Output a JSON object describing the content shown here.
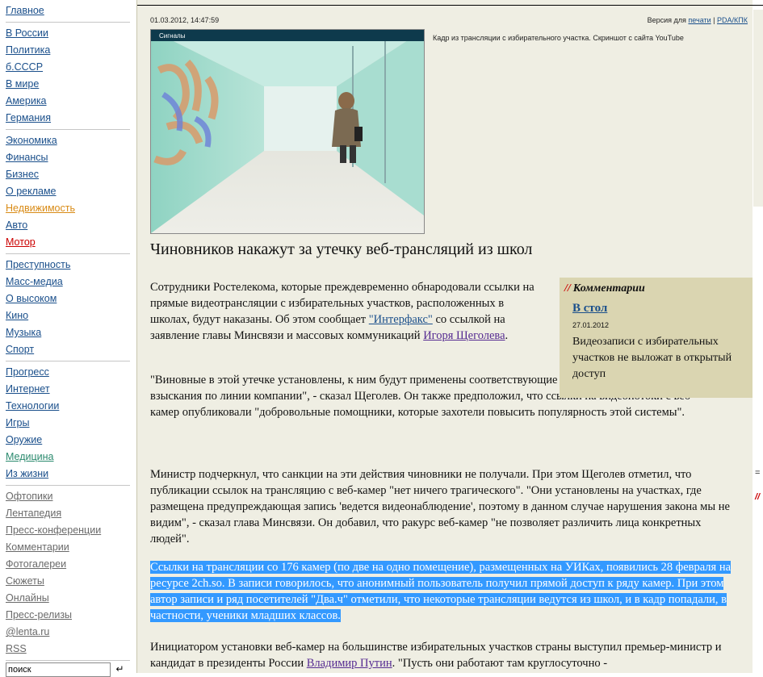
{
  "sidebar": {
    "groups": [
      {
        "items": [
          {
            "label": "Главное",
            "color": "default"
          }
        ]
      },
      {
        "items": [
          {
            "label": "В России",
            "color": "default"
          },
          {
            "label": "Политика",
            "color": "default"
          },
          {
            "label": "б.СССР",
            "color": "default"
          },
          {
            "label": "В мире",
            "color": "default"
          },
          {
            "label": "Америка",
            "color": "default"
          },
          {
            "label": "Германия",
            "color": "default"
          }
        ]
      },
      {
        "items": [
          {
            "label": "Экономика",
            "color": "default"
          },
          {
            "label": "Финансы",
            "color": "default"
          },
          {
            "label": "Бизнес",
            "color": "default"
          },
          {
            "label": "О рекламе",
            "color": "default"
          },
          {
            "label": "Недвижимость",
            "color": "orange"
          },
          {
            "label": "Авто",
            "color": "default"
          },
          {
            "label": "Мотор",
            "color": "red"
          }
        ]
      },
      {
        "items": [
          {
            "label": "Преступность",
            "color": "default"
          },
          {
            "label": "Масс-медиа",
            "color": "default"
          },
          {
            "label": "О высоком",
            "color": "default"
          },
          {
            "label": "Кино",
            "color": "default"
          },
          {
            "label": "Музыка",
            "color": "default"
          },
          {
            "label": "Спорт",
            "color": "default"
          }
        ]
      },
      {
        "items": [
          {
            "label": "Прогресс",
            "color": "default"
          },
          {
            "label": "Интернет",
            "color": "default"
          },
          {
            "label": "Технологии",
            "color": "default"
          },
          {
            "label": "Игры",
            "color": "default"
          },
          {
            "label": "Оружие",
            "color": "default"
          },
          {
            "label": "Медицина",
            "color": "teal"
          },
          {
            "label": "Из жизни",
            "color": "default"
          }
        ]
      },
      {
        "gray": true,
        "items": [
          {
            "label": "Офтопики",
            "color": "default"
          },
          {
            "label": "Лентапедия",
            "color": "default"
          },
          {
            "label": "Пресс-конференции",
            "color": "default"
          },
          {
            "label": "Комментарии",
            "color": "default"
          },
          {
            "label": "Фотогалереи",
            "color": "default"
          },
          {
            "label": "Сюжеты",
            "color": "default"
          },
          {
            "label": "Онлайны",
            "color": "default"
          },
          {
            "label": "Пресс-релизы",
            "color": "default"
          },
          {
            "label": "@lenta.ru",
            "color": "default"
          },
          {
            "label": "RSS",
            "color": "default"
          }
        ]
      }
    ],
    "search": {
      "value": "поиск",
      "enter_symbol": "↵"
    }
  },
  "article": {
    "datetime": "01.03.2012, 14:47:59",
    "version_prefix": "Версия для",
    "print_label": "печати",
    "separator": "|",
    "pda_label": "PDA/КПК",
    "photo_overlay": "Сигналы",
    "photo_caption": "Кадр из трансляции с избирательного участка. Скриншот с сайта YouTube",
    "headline": "Чиновников накажут за утечку веб-трансляций из школ",
    "p1": {
      "before": "Сотрудники Ростелекома, которые преждевременно обнародовали ссылки на прямые видеотрансляции с избирательных участков, расположенных в школах, будут наказаны. Об этом сообщает ",
      "link1": "\"Интерфакс\"",
      "middle": " со ссылкой на заявление главы Минсвязи и массовых коммуникаций ",
      "link2": "Игоря Щеголева",
      "after": "."
    },
    "p2": "\"Виновные в этой утечке установлены, к ним будут применены соответствующие меры административного взыскания по линии компании\", - сказал Щеголев. Он также предположил, что ссылки на видеопотоки с веб-камер опубликовали \"добровольные помощники, которые захотели повысить популярность этой системы\".",
    "p3": "Министр подчеркнул, что санкции на эти действия чиновники не получали. При этом Щеголев отметил, что публикации ссылок на трансляцию с веб-камер \"нет ничего трагического\". \"Они установлены на участках, где размещена предупреждающая запись 'ведется видеонаблюдение', поэтому в данном случае нарушения закона мы не видим\", - сказал глава Минсвязи. Он добавил, что ракурс веб-камер \"не позволяет различить лица конкретных людей\".",
    "p4": "Ссылки на трансляции со 176 камер (по две на одно помещение), размещенных на УИКах, появились 28 февраля на ресурсе 2ch.so. В записи говорилось, что анонимный пользователь получил прямой доступ к ряду камер. При этом автор записи и ряд посетителей \"Два.ч\" отметили, что некоторые трансляции ведутся из школ, и в кадр попадали, в частности, ученики младших классов.",
    "p5": {
      "before": "Инициатором установки веб-камер на большинстве избирательных участков страны выступил премьер-министр и кандидат в президенты России ",
      "link": "Владимир Путин",
      "after": ". \"Пусть они работают там круглосуточно -"
    }
  },
  "comments_box": {
    "slashes": "//",
    "heading": "Комментарии",
    "link": "В стол",
    "date": "27.01.2012",
    "text": "Видеозаписи с избирательных участков не выложат в открытый доступ"
  },
  "right_strip": {
    "eq": "=",
    "slashes": "//"
  },
  "colors": {
    "link": "#1a4f8b",
    "visited": "#552a91",
    "content_bg": "#efeee3",
    "box_bg": "#dad5b1",
    "highlight": "#3399ff",
    "accent_red": "#cc0000"
  }
}
